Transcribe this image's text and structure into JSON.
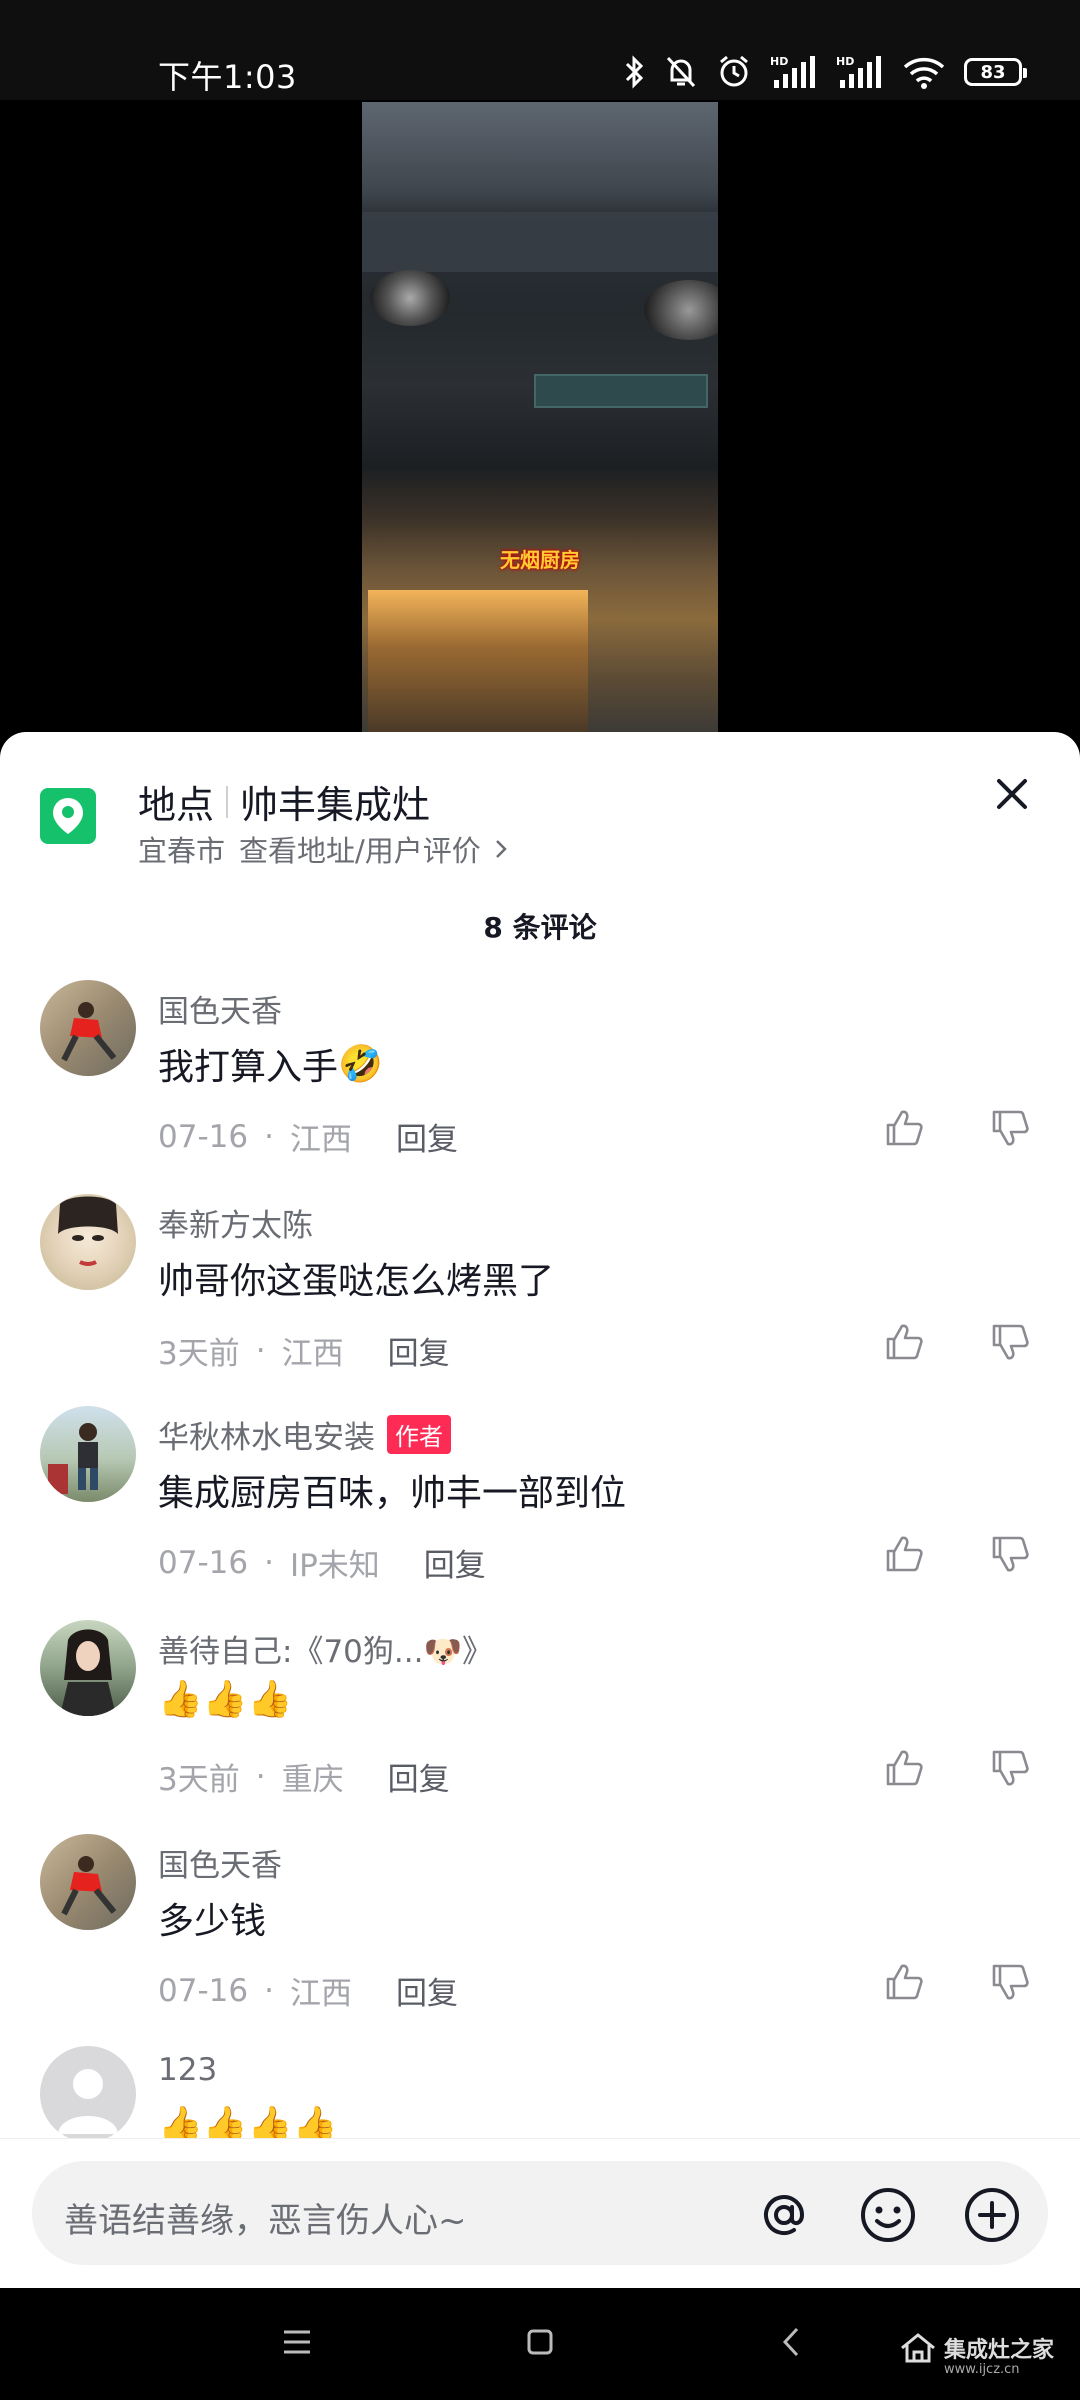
{
  "status_bar": {
    "time": "下午1:03",
    "battery": "83"
  },
  "video": {
    "caption": "无烟厨房"
  },
  "location": {
    "label": "地点",
    "name": "帅丰集成灶",
    "city": "宜春市",
    "link": "查看地址/用户评价",
    "icon": "location-pin-icon",
    "color": "#15c16b"
  },
  "comments_header": {
    "count_text": "8 条评论"
  },
  "comments": [
    {
      "user": "国色天香",
      "text": "我打算入手",
      "emoji": "🤣",
      "date": "07-16",
      "location": "江西",
      "reply": "回复"
    },
    {
      "user": "奉新方太陈",
      "text": "帅哥你这蛋哒怎么烤黑了",
      "emoji": "",
      "date": "3天前",
      "location": "江西",
      "reply": "回复"
    },
    {
      "user": "华秋林水电安装",
      "badge": "作者",
      "text": "集成厨房百味，帅丰一部到位",
      "emoji": "",
      "date": "07-16",
      "location": "IP未知",
      "reply": "回复"
    },
    {
      "user": "善待自己:《70狗...🐶》",
      "text": "",
      "emoji": "👍👍👍",
      "date": "3天前",
      "location": "重庆",
      "reply": "回复"
    },
    {
      "user": "国色天香",
      "text": "多少钱",
      "emoji": "",
      "date": "07-16",
      "location": "江西",
      "reply": "回复"
    },
    {
      "user": "123",
      "text": "",
      "emoji": "👍👍👍👍"
    }
  ],
  "input": {
    "placeholder": "善语结善缘，恶言伤人心~"
  },
  "colors": {
    "accent": "#fe2c55",
    "text": "#161823",
    "muted": "#a3a5ab"
  },
  "watermark": {
    "name": "集成灶之家",
    "url": "www.ijcz.cn"
  }
}
